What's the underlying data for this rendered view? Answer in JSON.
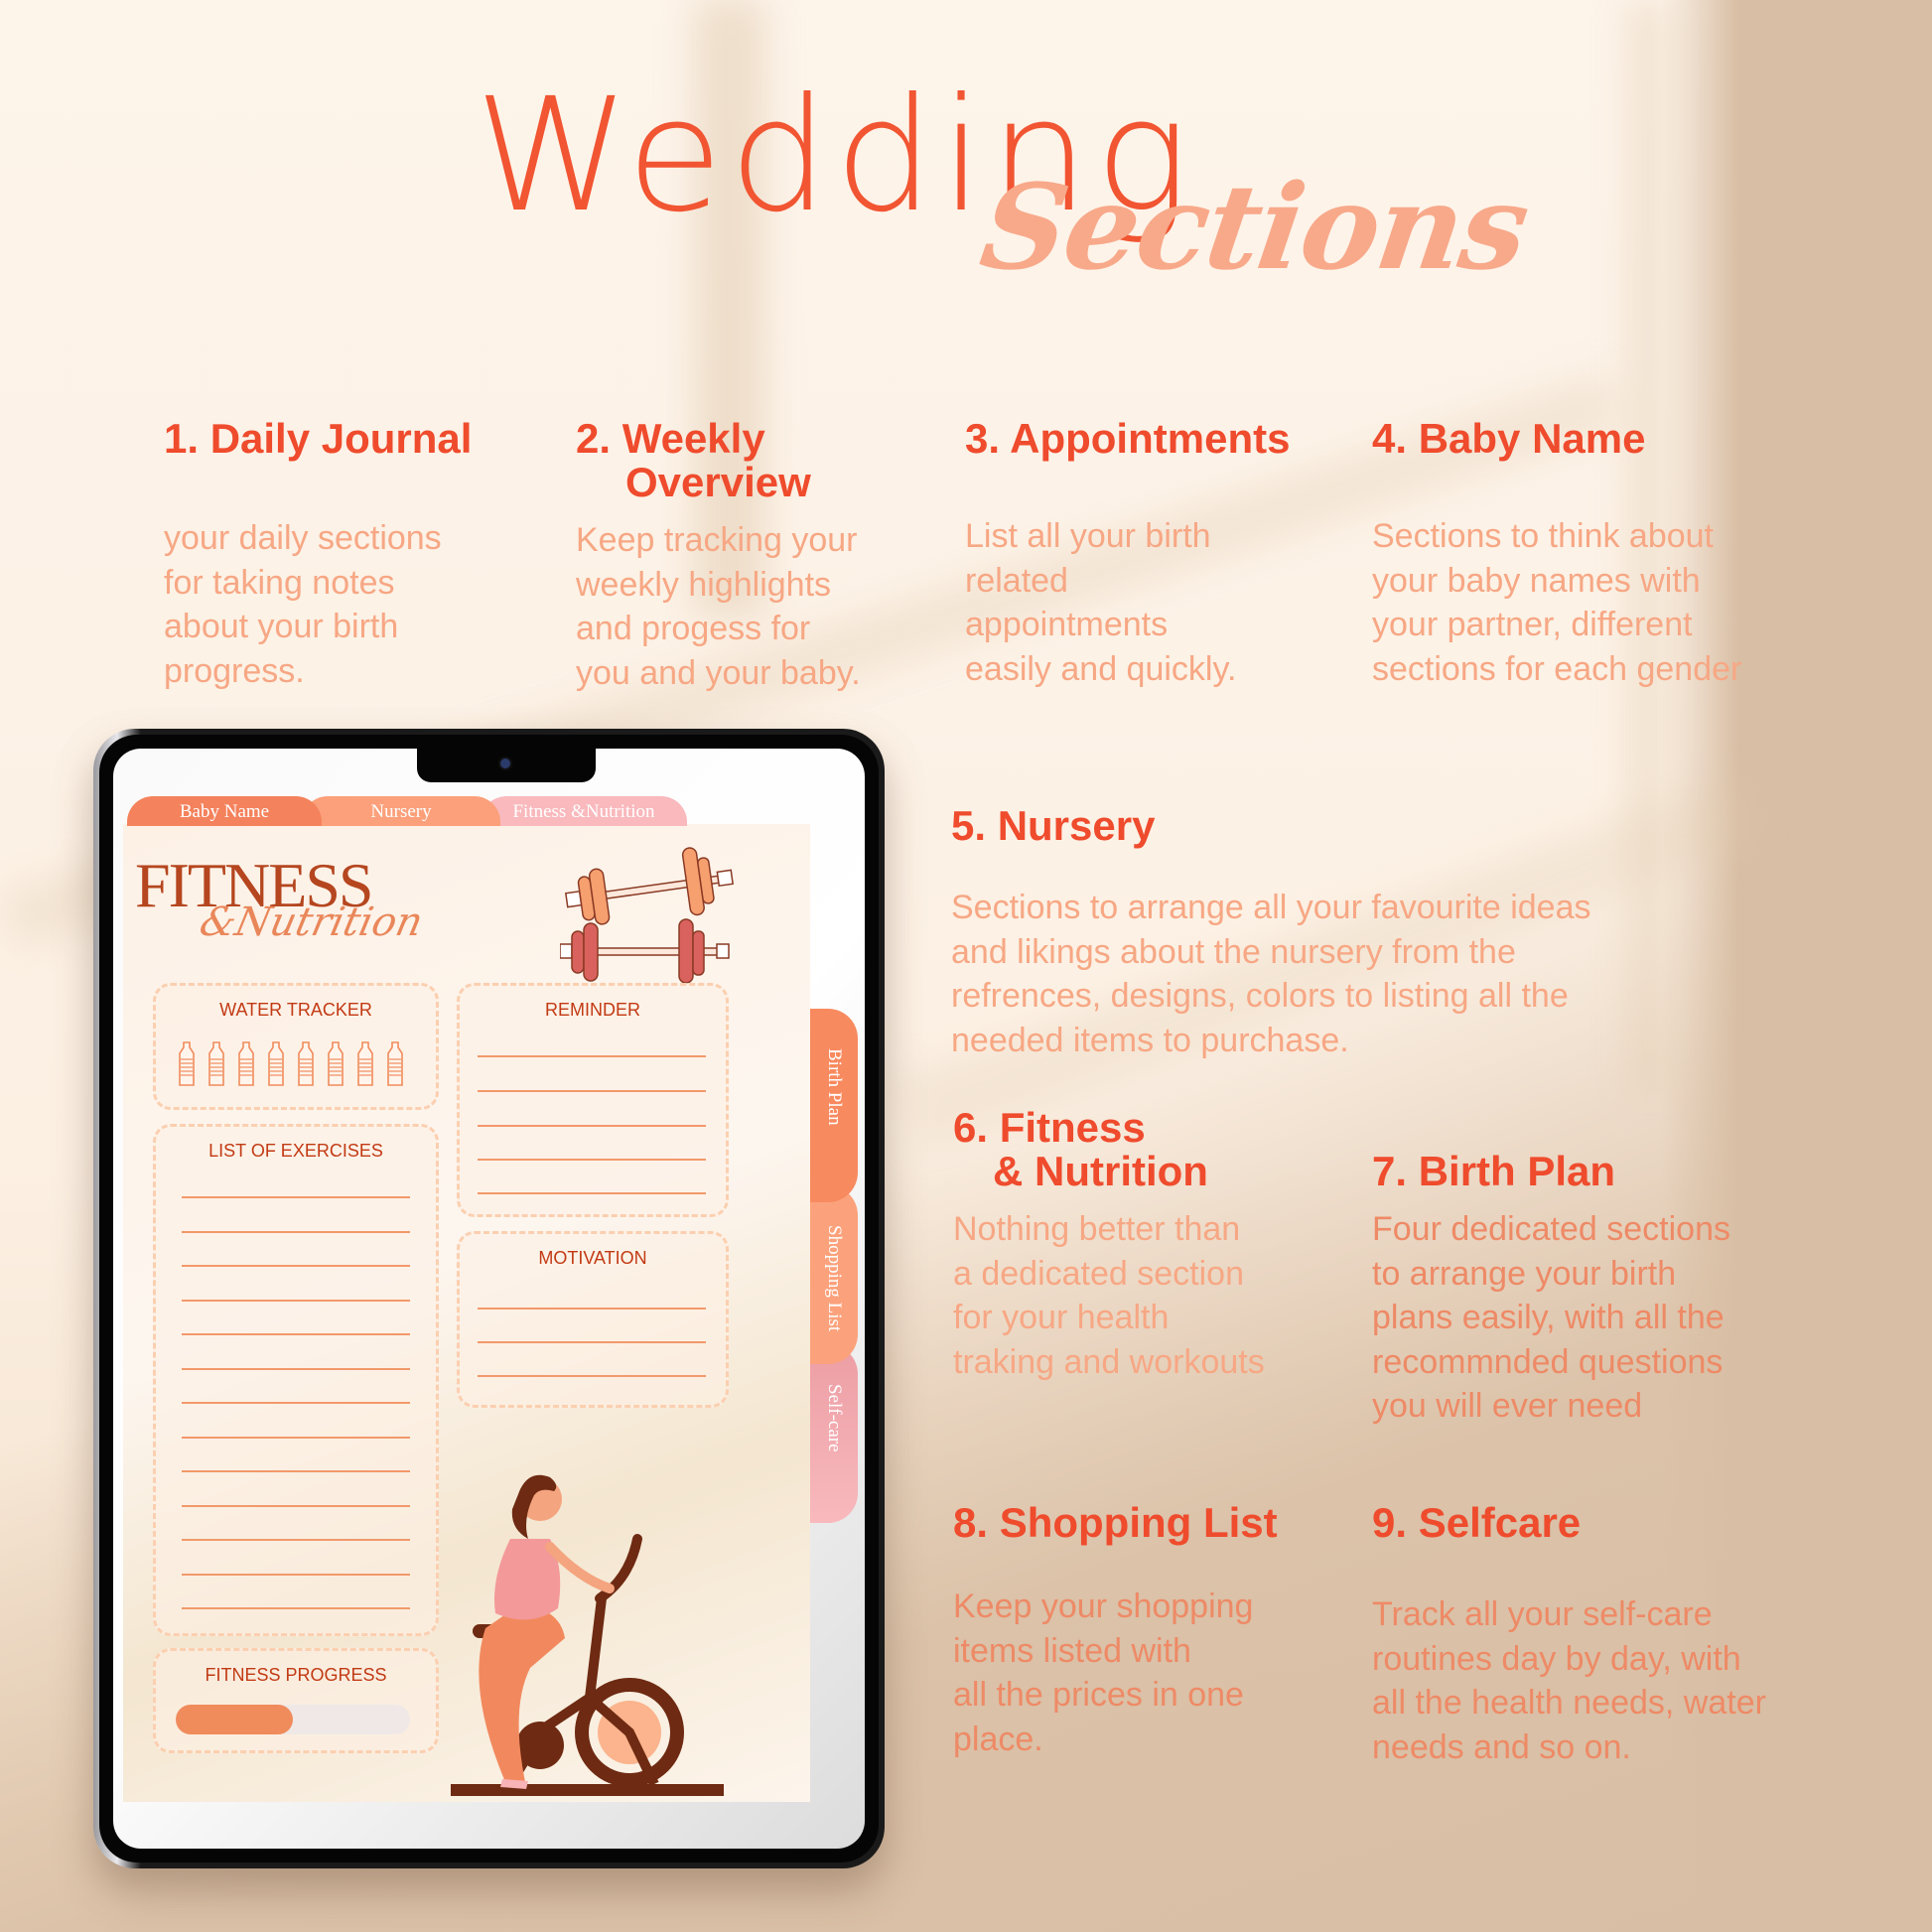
{
  "header": {
    "title_main": "Wedding",
    "title_script": "Sections"
  },
  "sections": [
    {
      "heading": "1. Daily Journal",
      "heading_line2": "",
      "body": [
        "your daily sections",
        "for taking notes",
        "about your birth",
        "progress."
      ]
    },
    {
      "heading": "2. Weekly",
      "heading_line2": "Overview",
      "body": [
        "Keep tracking your",
        "weekly highlights",
        "and progess for",
        "you and your baby."
      ]
    },
    {
      "heading": "3. Appointments",
      "heading_line2": "",
      "body": [
        "List all your birth",
        "related",
        "appointments",
        "easily and quickly."
      ]
    },
    {
      "heading": "4. Baby Name",
      "heading_line2": "",
      "body": [
        "Sections to think about",
        "your baby names with",
        "your partner, different",
        "sections for each gender"
      ]
    },
    {
      "heading": "5. Nursery",
      "heading_line2": "",
      "body": [
        "Sections to arrange all your favourite ideas",
        "and likings about the nursery from the",
        "refrences, designs, colors to listing all the",
        "needed items to purchase."
      ]
    },
    {
      "heading": "6. Fitness",
      "heading_line2": "& Nutrition",
      "body": [
        "Nothing better than",
        "a dedicated section",
        "for your health",
        "traking and workouts"
      ]
    },
    {
      "heading": "7. Birth Plan",
      "heading_line2": "",
      "body": [
        "Four dedicated sections",
        "to arrange your birth",
        "plans easily, with all the",
        "recommnded questions",
        "you will ever need"
      ]
    },
    {
      "heading": "8. Shopping List",
      "heading_line2": "",
      "body": [
        "Keep your shopping",
        "items listed with",
        "all the prices in one",
        "place."
      ]
    },
    {
      "heading": "9. Selfcare",
      "heading_line2": "",
      "body": [
        "Track all your self-care",
        "routines day by day, with",
        "all the health needs, water",
        "needs and so on."
      ]
    }
  ],
  "tablet": {
    "top_tabs": [
      {
        "label": "Baby Name",
        "color": "#f4825c"
      },
      {
        "label": "Nursery",
        "color": "#fba07a"
      },
      {
        "label": "Fitness &Nutrition",
        "color": "#f9b9bd"
      }
    ],
    "side_tabs": [
      {
        "label": "Birth Plan",
        "color": "#f88a5f"
      },
      {
        "label": "Shopping List",
        "color": "#fba27c"
      },
      {
        "label": "Self-care",
        "color": "#f3a5ad"
      }
    ],
    "page_title": "FITNESS",
    "page_subtitle": "&Nutrition",
    "boxes": {
      "water_tracker": "WATER TRACKER",
      "reminder": "REMINDER",
      "list_of_exercises": "LIST OF EXERCISES",
      "motivation": "MOTIVATION",
      "fitness_progress": "FITNESS PROGRESS"
    },
    "water_bottles": 8,
    "fitness_progress_percent": 50,
    "icons": [
      "dumbbell-icon",
      "water-bottle-icon",
      "woman-on-exercise-bike-illustration",
      "camera-icon"
    ]
  },
  "colors": {
    "heading": "#ef4b2d",
    "body": "#f7a784",
    "accent_orange": "#f08b5c",
    "brown": "#6e2a12"
  }
}
